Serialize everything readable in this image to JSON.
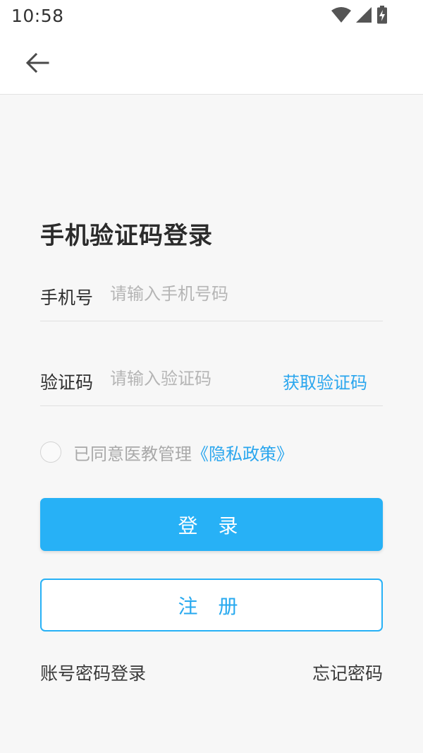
{
  "status_bar": {
    "time": "10:58",
    "icons": [
      "wifi-icon",
      "signal-icon",
      "battery-charging-icon"
    ]
  },
  "app_bar": {
    "back_icon": "arrow-back-icon"
  },
  "main": {
    "title": "手机验证码登录",
    "phone_field": {
      "label": "手机号",
      "placeholder": "请输入手机号码",
      "value": ""
    },
    "code_field": {
      "label": "验证码",
      "placeholder": "请输入验证码",
      "value": "",
      "get_code_label": "获取验证码"
    },
    "agreement": {
      "checked": false,
      "text": "已同意医教管理",
      "link": "《隐私政策》"
    },
    "login_label": "登 录",
    "register_label": "注 册",
    "password_login_label": "账号密码登录",
    "forgot_password_label": "忘记密码"
  },
  "colors": {
    "accent": "#27b1f6",
    "link": "#2aa6ee",
    "background": "#f7f7f7"
  }
}
